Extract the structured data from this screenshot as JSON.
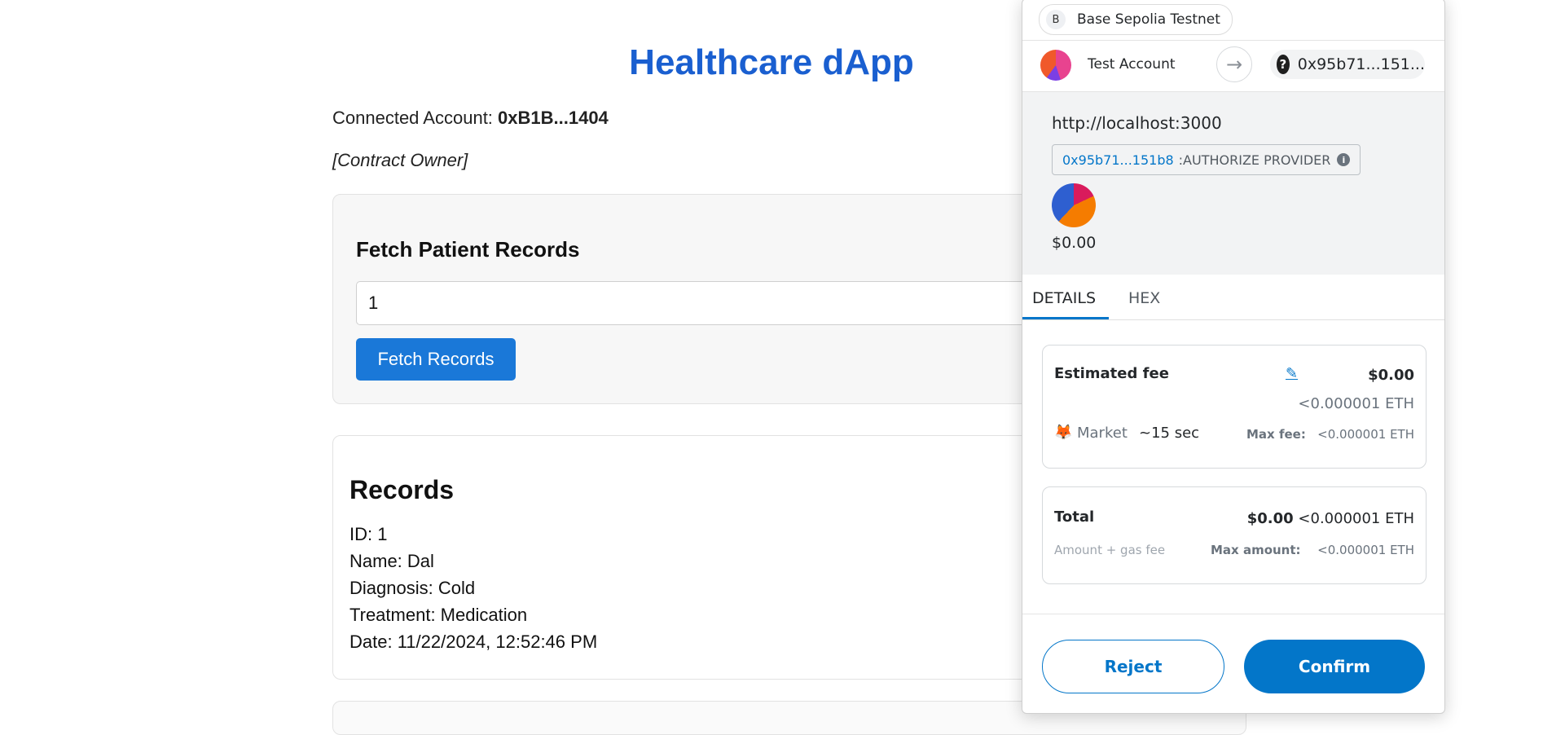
{
  "dapp": {
    "title": "Healthcare dApp",
    "connected_label": "Connected Account: ",
    "connected_account": "0xB1B...1404",
    "role": "[Contract Owner]",
    "fetch_section": {
      "heading": "Fetch Patient Records",
      "patient_id_value": "1",
      "button_label": "Fetch Records"
    },
    "records_section": {
      "heading": "Records",
      "lines": [
        "ID: 1",
        "Name: Dal",
        "Diagnosis: Cold",
        "Treatment: Medication",
        "Date: 11/22/2024, 12:52:46 PM"
      ]
    }
  },
  "metamask": {
    "network": {
      "badge": "B",
      "name": "Base Sepolia Testnet"
    },
    "from_account": "Test Account",
    "to_address": "0x95b71...151...",
    "to_icon": "question-icon",
    "origin": "http://localhost:3000",
    "auth": {
      "address": "0x95b71...151b8",
      "separator": " : ",
      "label": "AUTHORIZE PROVIDER"
    },
    "value": "$0.00",
    "tabs": [
      "DETAILS",
      "HEX"
    ],
    "active_tab": "DETAILS",
    "estimated_fee": {
      "label": "Estimated fee",
      "fiat": "$0.00",
      "eth": "<0.000001 ETH",
      "speed_label": "Market",
      "speed_time": "~15 sec",
      "max_fee_label": "Max fee:",
      "max_fee_value": "<0.000001 ETH"
    },
    "total": {
      "label": "Total",
      "fiat": "$0.00",
      "eth": "<0.000001 ETH",
      "sub_label": "Amount + gas fee",
      "max_amount_label": "Max amount:",
      "max_amount_value": "<0.000001 ETH"
    },
    "buttons": {
      "reject": "Reject",
      "confirm": "Confirm"
    },
    "colors": {
      "accent": "#0376c9",
      "dapp_title": "#1a5fd0",
      "dapp_button": "#1a78d8"
    }
  }
}
